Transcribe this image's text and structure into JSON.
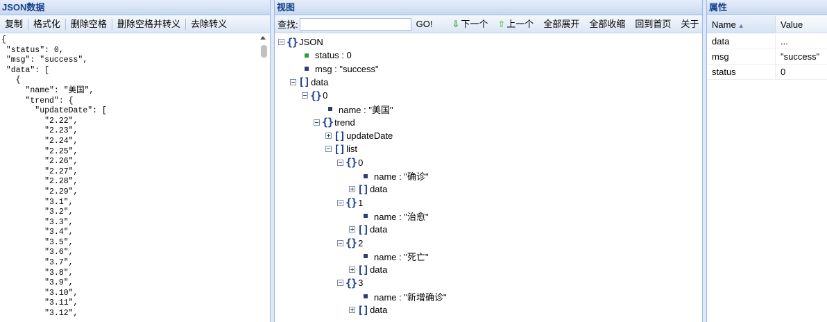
{
  "left": {
    "title": "JSON数据",
    "toolbar": [
      "复制",
      "格式化",
      "删除空格",
      "删除空格并转义",
      "去除转义"
    ],
    "code_lines": [
      "{",
      " \"status\": 0,",
      " \"msg\": \"success\",",
      " \"data\": [",
      "   {",
      "     \"name\": \"美国\",",
      "     \"trend\": {",
      "       \"updateDate\": [",
      "         \"2.22\",",
      "         \"2.23\",",
      "         \"2.24\",",
      "         \"2.25\",",
      "         \"2.26\",",
      "         \"2.27\",",
      "         \"2.28\",",
      "         \"2.29\",",
      "         \"3.1\",",
      "         \"3.2\",",
      "         \"3.3\",",
      "         \"3.4\",",
      "         \"3.5\",",
      "         \"3.6\",",
      "         \"3.7\",",
      "         \"3.8\",",
      "         \"3.9\",",
      "         \"3.10\",",
      "         \"3.11\",",
      "         \"3.12\","
    ]
  },
  "middle": {
    "title": "视图",
    "search_label": "查找:",
    "search_value": "",
    "go_label": "GO!",
    "next_label": "下一个",
    "prev_label": "上一个",
    "expand_all_label": "全部展开",
    "collapse_all_label": "全部收缩",
    "home_label": "回到首页",
    "about_label": "关于",
    "tree": [
      {
        "depth": 0,
        "kind": "object",
        "toggle": "minus",
        "label": "JSON"
      },
      {
        "depth": 1,
        "kind": "leaf-green",
        "label": "status : 0"
      },
      {
        "depth": 1,
        "kind": "leaf",
        "label": "msg : \"success\""
      },
      {
        "depth": 1,
        "kind": "array",
        "toggle": "minus",
        "label": "data"
      },
      {
        "depth": 2,
        "kind": "object",
        "toggle": "minus",
        "label": "0"
      },
      {
        "depth": 3,
        "kind": "leaf",
        "label": "name : \"美国\""
      },
      {
        "depth": 3,
        "kind": "object",
        "toggle": "minus",
        "label": "trend"
      },
      {
        "depth": 4,
        "kind": "array",
        "toggle": "plus",
        "label": "updateDate"
      },
      {
        "depth": 4,
        "kind": "array",
        "toggle": "minus",
        "label": "list"
      },
      {
        "depth": 5,
        "kind": "object",
        "toggle": "minus",
        "label": "0"
      },
      {
        "depth": 6,
        "kind": "leaf",
        "label": "name : \"确诊\""
      },
      {
        "depth": 6,
        "kind": "array",
        "toggle": "plus",
        "label": "data"
      },
      {
        "depth": 5,
        "kind": "object",
        "toggle": "minus",
        "label": "1"
      },
      {
        "depth": 6,
        "kind": "leaf",
        "label": "name : \"治愈\""
      },
      {
        "depth": 6,
        "kind": "array",
        "toggle": "plus",
        "label": "data"
      },
      {
        "depth": 5,
        "kind": "object",
        "toggle": "minus",
        "label": "2"
      },
      {
        "depth": 6,
        "kind": "leaf",
        "label": "name : \"死亡\""
      },
      {
        "depth": 6,
        "kind": "array",
        "toggle": "plus",
        "label": "data"
      },
      {
        "depth": 5,
        "kind": "object",
        "toggle": "minus",
        "label": "3"
      },
      {
        "depth": 6,
        "kind": "leaf",
        "label": "name : \"新增确诊\""
      },
      {
        "depth": 6,
        "kind": "array",
        "toggle": "plus",
        "label": "data"
      }
    ]
  },
  "right": {
    "title": "属性",
    "col_name": "Name",
    "col_value": "Value",
    "rows": [
      {
        "name": "data",
        "value": "..."
      },
      {
        "name": "msg",
        "value": "\"success\""
      },
      {
        "name": "status",
        "value": "0"
      }
    ]
  },
  "icons": {
    "next": "arrow-down-icon",
    "prev": "arrow-up-icon",
    "sort": "sort-ascending-icon"
  },
  "colors": {
    "header_text": "#15428b",
    "bracket": "#1c3f94",
    "leaf_number": "#2e9b3b",
    "leaf_string": "#2c3d74",
    "arrow_down": "#3b9b2a",
    "arrow_up": "#74c15e"
  }
}
